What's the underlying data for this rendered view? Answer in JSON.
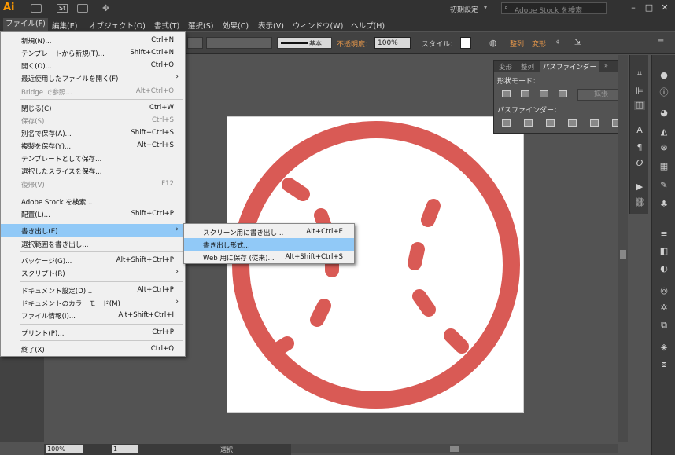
{
  "app": {
    "logo": "Ai",
    "bridge_label": "St",
    "workspace": "初期設定",
    "search_placeholder": "Adobe Stock を検索"
  },
  "menubar": [
    "ファイル(F)",
    "編集(E)",
    "オブジェクト(O)",
    "書式(T)",
    "選択(S)",
    "効果(C)",
    "表示(V)",
    "ウィンドウ(W)",
    "ヘルプ(H)"
  ],
  "control": {
    "stroke_style": "基本",
    "opacity_label": "不透明度：",
    "opacity_value": "100%",
    "style_label": "スタイル：",
    "align_label": "整列",
    "transform_label": "変形"
  },
  "file_menu": [
    {
      "label": "新規(N)...",
      "shortcut": "Ctrl+N",
      "enabled": true
    },
    {
      "label": "テンプレートから新規(T)...",
      "shortcut": "Shift+Ctrl+N",
      "enabled": true
    },
    {
      "label": "開く(O)...",
      "shortcut": "Ctrl+O",
      "enabled": true
    },
    {
      "label": "最近使用したファイルを開く(F)",
      "shortcut": "",
      "enabled": true
    },
    {
      "label": "Bridge で参照...",
      "shortcut": "Alt+Ctrl+O",
      "enabled": false
    },
    {
      "label": "閉じる(C)",
      "shortcut": "Ctrl+W",
      "enabled": true
    },
    {
      "label": "保存(S)",
      "shortcut": "Ctrl+S",
      "enabled": false
    },
    {
      "label": "別名で保存(A)...",
      "shortcut": "Shift+Ctrl+S",
      "enabled": true
    },
    {
      "label": "複製を保存(Y)...",
      "shortcut": "Alt+Ctrl+S",
      "enabled": true
    },
    {
      "label": "テンプレートとして保存...",
      "shortcut": "",
      "enabled": true
    },
    {
      "label": "選択したスライスを保存...",
      "shortcut": "",
      "enabled": true
    },
    {
      "label": "復帰(V)",
      "shortcut": "F12",
      "enabled": false
    },
    {
      "label": "Adobe Stock を検索...",
      "shortcut": "",
      "enabled": true
    },
    {
      "label": "配置(L)...",
      "shortcut": "Shift+Ctrl+P",
      "enabled": true
    },
    {
      "label": "書き出し(E)",
      "shortcut": "",
      "enabled": true
    },
    {
      "label": "選択範囲を書き出し...",
      "shortcut": "",
      "enabled": true
    },
    {
      "label": "パッケージ(G)...",
      "shortcut": "Alt+Shift+Ctrl+P",
      "enabled": true
    },
    {
      "label": "スクリプト(R)",
      "shortcut": "",
      "enabled": true
    },
    {
      "label": "ドキュメント設定(D)...",
      "shortcut": "Alt+Ctrl+P",
      "enabled": true
    },
    {
      "label": "ドキュメントのカラーモード(M)",
      "shortcut": "",
      "enabled": true
    },
    {
      "label": "ファイル情報(I)...",
      "shortcut": "Alt+Shift+Ctrl+I",
      "enabled": true
    },
    {
      "label": "プリント(P)...",
      "shortcut": "Ctrl+P",
      "enabled": true
    },
    {
      "label": "終了(X)",
      "shortcut": "Ctrl+Q",
      "enabled": true
    }
  ],
  "export_submenu": [
    {
      "label": "スクリーン用に書き出し...",
      "shortcut": "Alt+Ctrl+E"
    },
    {
      "label": "書き出し形式...",
      "shortcut": ""
    },
    {
      "label": "Web 用に保存 (従来)...",
      "shortcut": "Alt+Shift+Ctrl+S"
    }
  ],
  "pathfinder": {
    "tabs": [
      "変形",
      "整列",
      "パスファインダー"
    ],
    "shape_modes": "形状モード：",
    "expand": "拡張",
    "pathfinders": "パスファインダー："
  },
  "status": {
    "zoom": "100%",
    "page": "1",
    "tool": "選択"
  },
  "colors": {
    "accent": "#d95a55",
    "highlight": "#91c9f7"
  }
}
